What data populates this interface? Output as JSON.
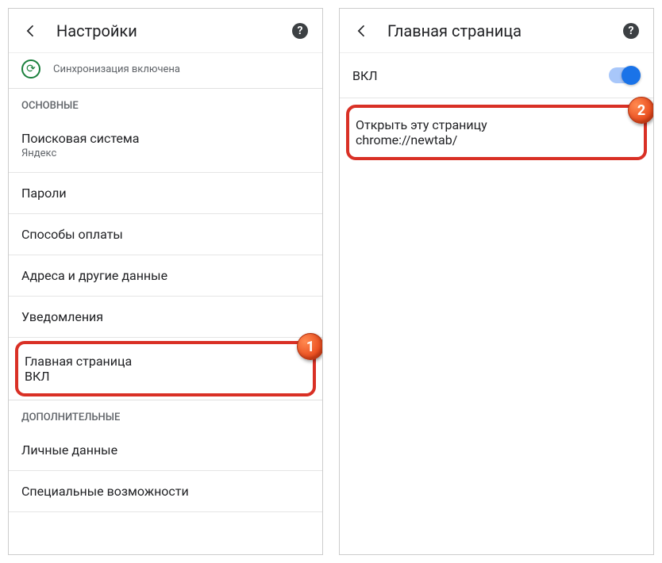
{
  "left": {
    "appbar": {
      "title": "Настройки"
    },
    "sync": {
      "subtitle": "Синхронизация включена"
    },
    "sections": {
      "basic_header": "ОСНОВНЫЕ",
      "advanced_header": "ДОПОЛНИТЕЛЬНЫЕ"
    },
    "items": {
      "search_engine": {
        "label": "Поисковая система",
        "value": "Яндекс"
      },
      "passwords": {
        "label": "Пароли"
      },
      "payments": {
        "label": "Способы оплаты"
      },
      "addresses": {
        "label": "Адреса и другие данные"
      },
      "notifications": {
        "label": "Уведомления"
      },
      "homepage": {
        "label": "Главная страница",
        "value": "ВКЛ"
      },
      "privacy": {
        "label": "Личные данные"
      },
      "accessibility": {
        "label": "Специальные возможности"
      }
    },
    "callout": "1"
  },
  "right": {
    "appbar": {
      "title": "Главная страница"
    },
    "toggle": {
      "label": "ВКЛ",
      "on": true
    },
    "open_page": {
      "label": "Открыть эту страницу",
      "value": "chrome://newtab/"
    },
    "callout": "2"
  }
}
